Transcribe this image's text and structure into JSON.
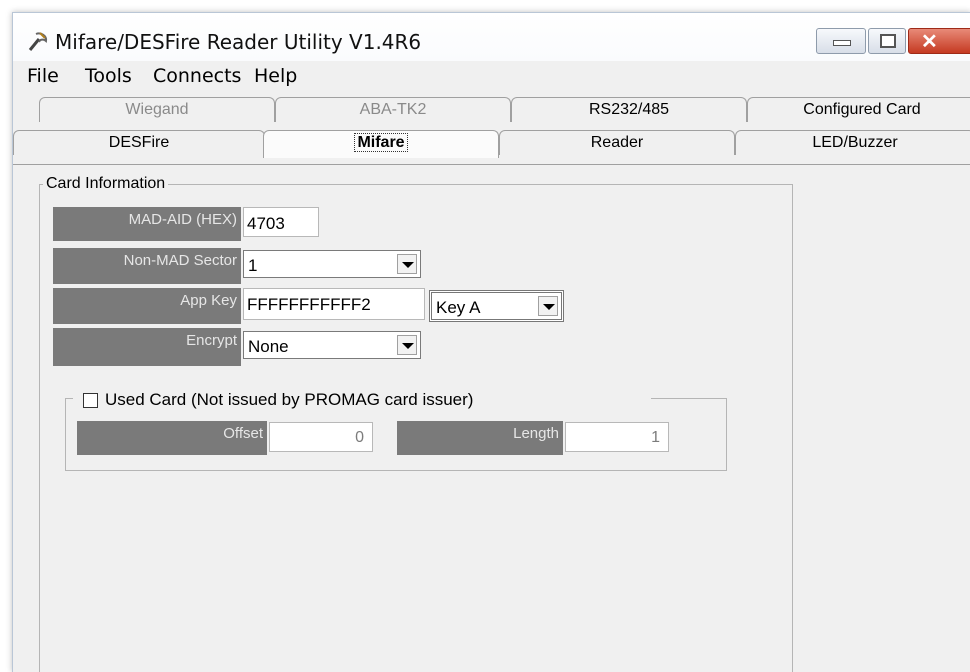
{
  "window": {
    "title": "Mifare/DESFire Reader Utility V1.4R6"
  },
  "menu": [
    "File",
    "Tools",
    "Connects",
    "Help"
  ],
  "tabs_row1": [
    "Wiegand",
    "ABA-TK2",
    "RS232/485",
    "Configured Card"
  ],
  "tabs_row2": [
    "DESFire",
    "Mifare",
    "Reader",
    "LED/Buzzer"
  ],
  "active_tab": "Mifare",
  "card_info": {
    "legend": "Card Information",
    "mad_aid_label": "MAD-AID (HEX)",
    "mad_aid_value": "4703",
    "non_mad_label": "Non-MAD Sector",
    "non_mad_value": "1",
    "app_key_label": "App Key",
    "app_key_value": "FFFFFFFFFFF2",
    "key_type_value": "Key A",
    "encrypt_label": "Encrypt",
    "encrypt_value": "None"
  },
  "used_card": {
    "label": "Used Card (Not issued by PROMAG card issuer)",
    "checked": false,
    "offset_label": "Offset",
    "offset_value": "0",
    "length_label": "Length",
    "length_value": "1"
  }
}
